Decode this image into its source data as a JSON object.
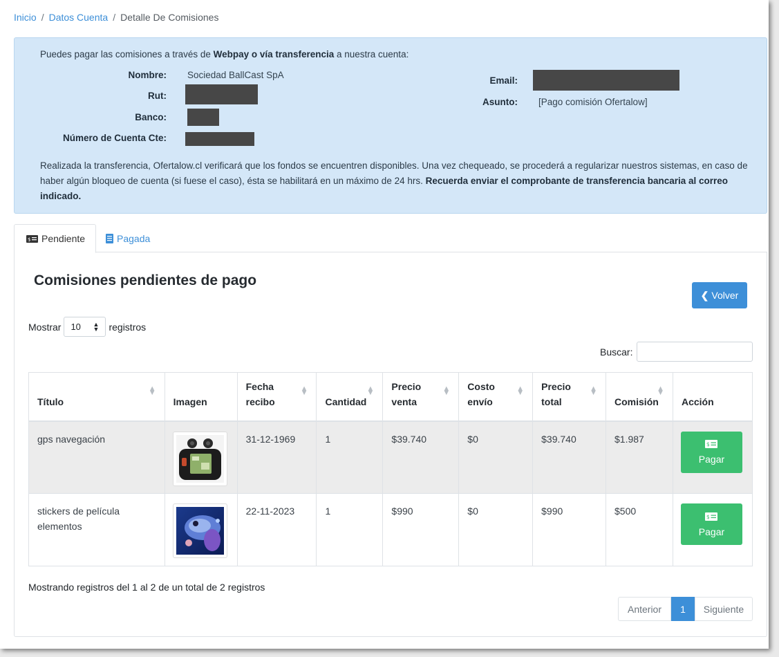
{
  "breadcrumb": {
    "home": "Inicio",
    "account": "Datos Cuenta",
    "current": "Detalle De Comisiones"
  },
  "info": {
    "intro_pre": "Puedes pagar las comisiones a través de",
    "intro_bold": "Webpay o vía transferencia",
    "intro_post": "a nuestra cuenta:",
    "labels": {
      "nombre": "Nombre:",
      "rut": "Rut:",
      "banco": "Banco:",
      "cuenta": "Número de Cuenta Cte:",
      "email": "Email:",
      "asunto": "Asunto:"
    },
    "values": {
      "nombre": "Sociedad BallCast SpA",
      "asunto": "[Pago comisión Ofertalow]"
    },
    "note": "Realizada la transferencia, Ofertalow.cl verificará que los fondos se encuentren disponibles. Una vez chequeado, se procederá a regularizar nuestros sistemas, en caso de haber algún bloqueo de cuenta (si fuese el caso), ésta se habilitará en un máximo de 24 hrs.",
    "note_bold": "Recuerda enviar el comprobante de transferencia bancaria al correo indicado."
  },
  "tabs": [
    {
      "label": "Pendiente",
      "icon": "money-bill-icon"
    },
    {
      "label": "Pagada",
      "icon": "receipt-icon"
    }
  ],
  "panel": {
    "title": "Comisiones pendientes de pago",
    "back_label": "Volver"
  },
  "controls": {
    "show_label": "Mostrar",
    "page_size": "10",
    "records_label": "registros",
    "search_label": "Buscar:"
  },
  "table": {
    "headers": [
      {
        "l1": "",
        "l2": "Título"
      },
      {
        "l1": "",
        "l2": "Imagen"
      },
      {
        "l1": "Fecha",
        "l2": "recibo"
      },
      {
        "l1": "",
        "l2": "Cantidad"
      },
      {
        "l1": "Precio",
        "l2": "venta"
      },
      {
        "l1": "Costo",
        "l2": "envío"
      },
      {
        "l1": "Precio",
        "l2": "total"
      },
      {
        "l1": "",
        "l2": "Comisión"
      },
      {
        "l1": "",
        "l2": "Acción"
      }
    ],
    "rows": [
      {
        "titulo": "gps navegación",
        "fecha": "31-12-1969",
        "cantidad": "1",
        "precio_venta": "$39.740",
        "costo_envio": "$0",
        "precio_total": "$39.740",
        "comision": "$1.987",
        "accion": "Pagar"
      },
      {
        "titulo": "stickers de película elementos",
        "fecha": "22-11-2023",
        "cantidad": "1",
        "precio_venta": "$990",
        "costo_envio": "$0",
        "precio_total": "$990",
        "comision": "$500",
        "accion": "Pagar"
      }
    ]
  },
  "footer": {
    "summary": "Mostrando registros del 1 al 2 de un total de 2 registros",
    "prev": "Anterior",
    "page": "1",
    "next": "Siguiente"
  },
  "colors": {
    "link": "#3d8fd8",
    "info_bg": "#d4e7f8",
    "success": "#3cbf70",
    "primary": "#3d8fd8"
  }
}
